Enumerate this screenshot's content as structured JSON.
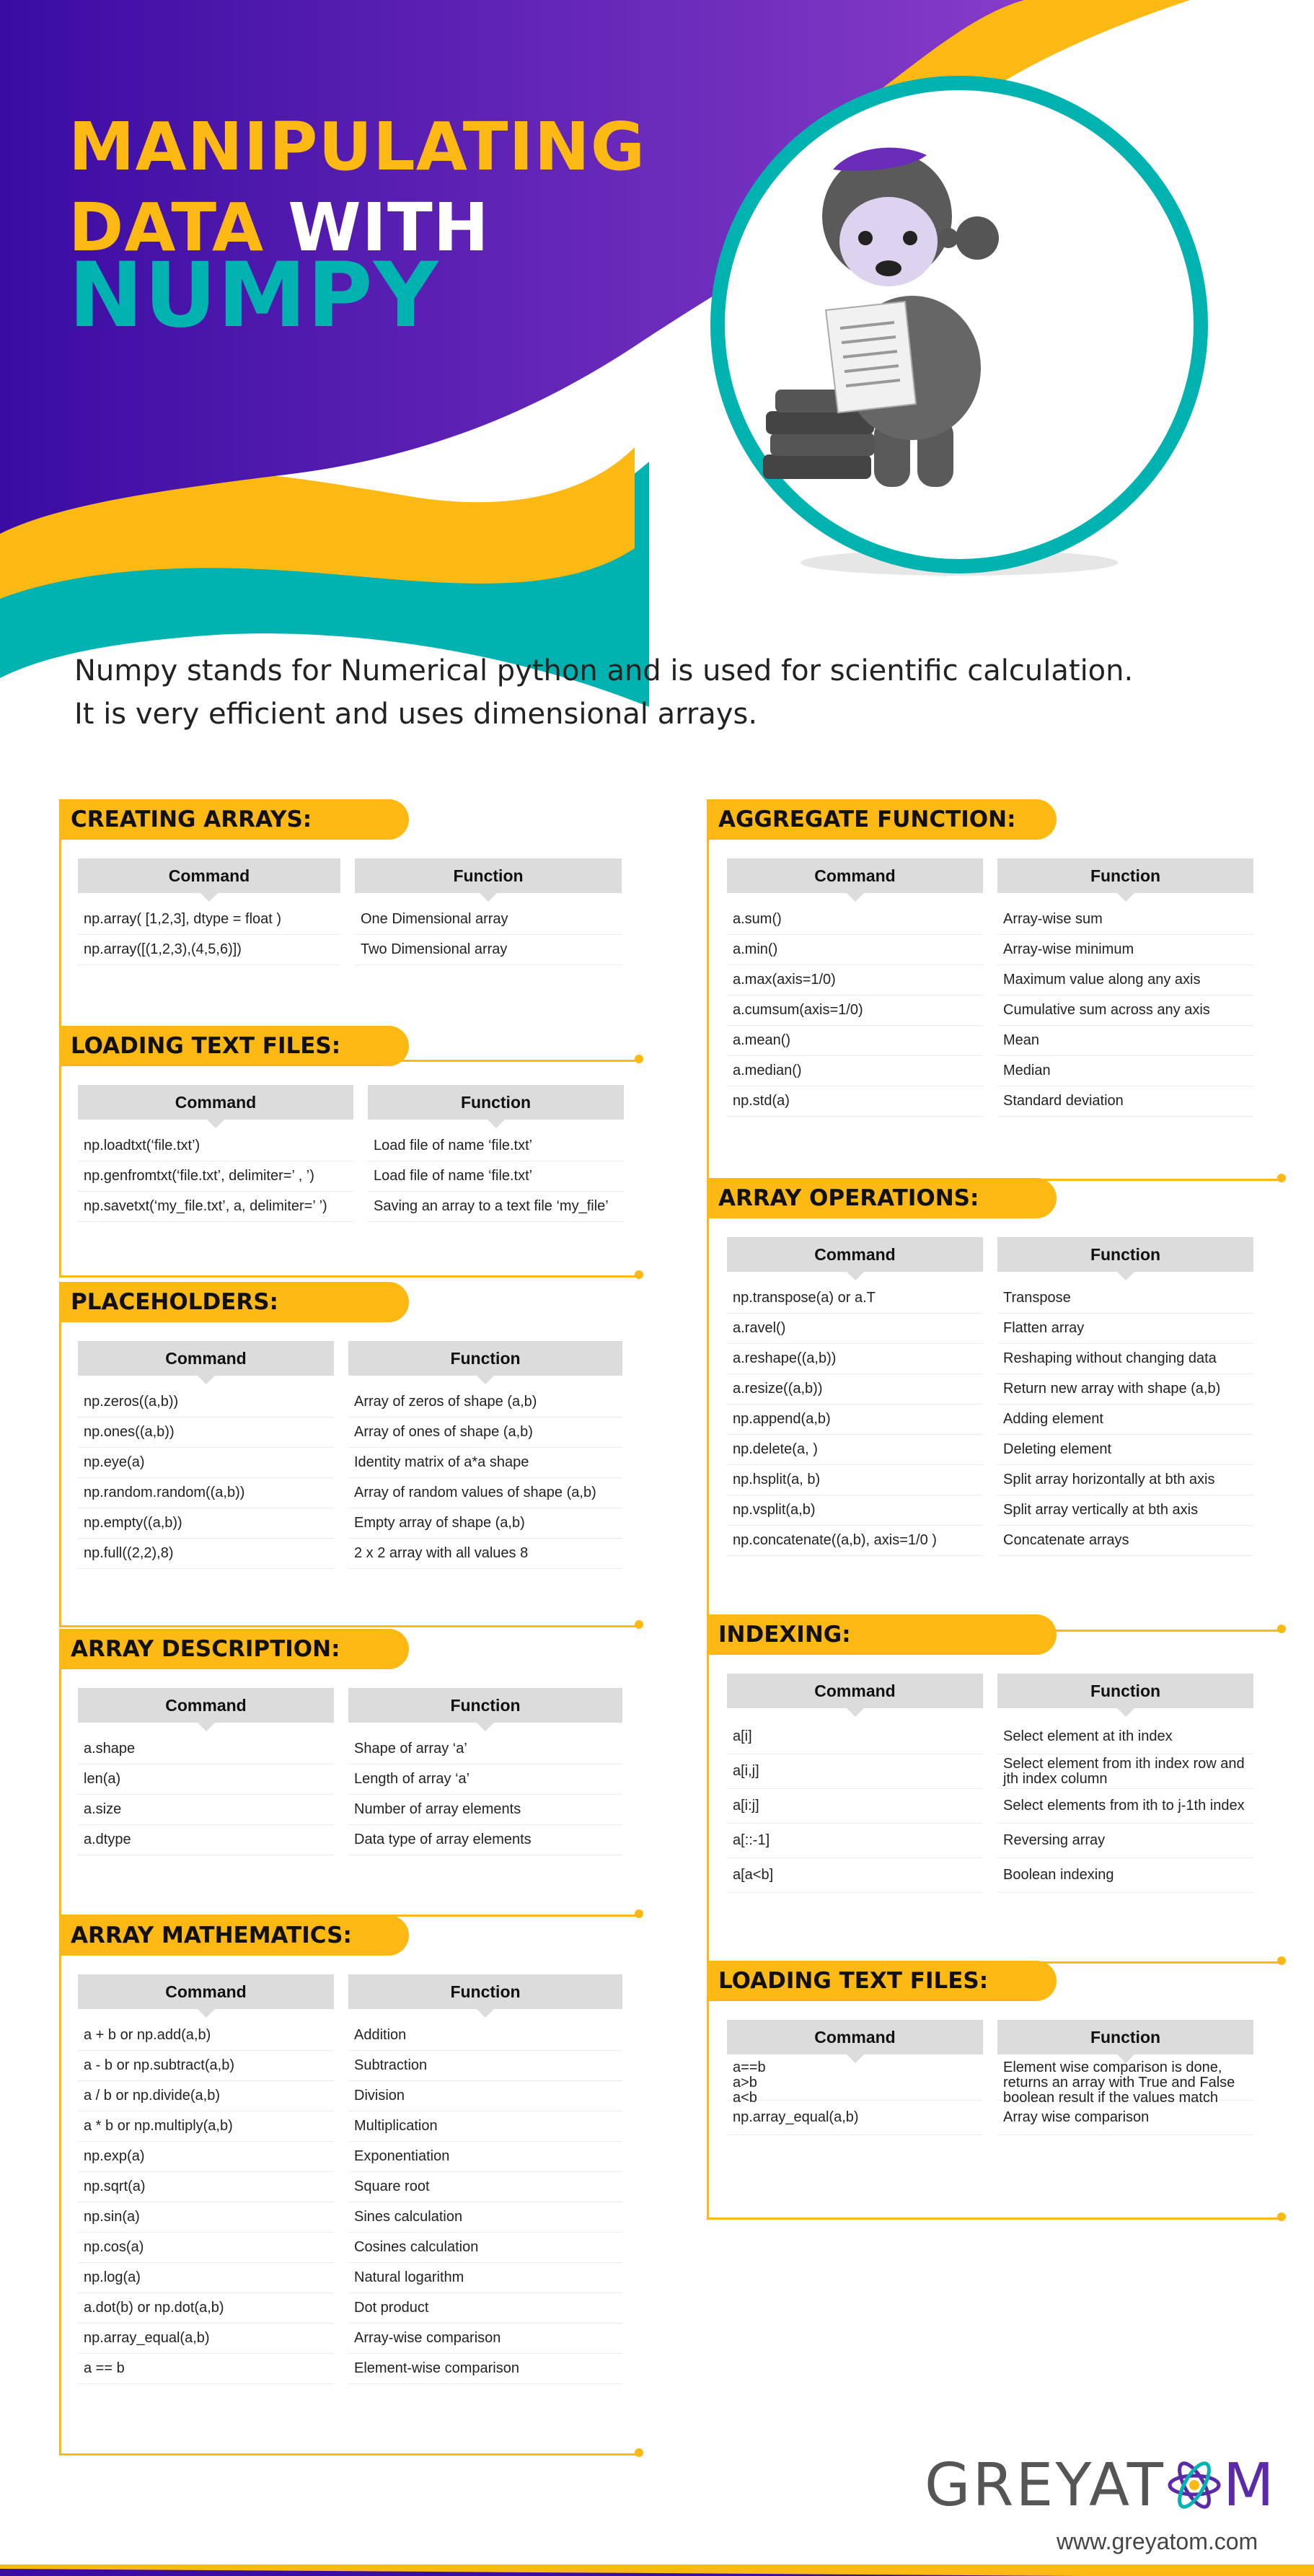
{
  "title": {
    "line1": "MANIPULATING",
    "line2a": "DATA",
    "line2b": " WITH",
    "line3": "NUMPY"
  },
  "intro": {
    "line1": "Numpy stands for Numerical python and is used for scientific calculation.",
    "line2": "It is very efficient and uses dimensional arrays."
  },
  "colors": {
    "purple": "#3e0fa8",
    "yellow": "#fdb913",
    "teal": "#00b3b0",
    "header_gray": "#dcdcdc"
  },
  "sections": [
    {
      "title": "CREATING ARRAYS:",
      "headers": [
        "Command",
        "Function"
      ],
      "rows": [
        [
          "np.array( [1,2,3], dtype = float )",
          "One Dimensional array"
        ],
        [
          "np.array([(1,2,3),(4,5,6)])",
          "Two Dimensional  array"
        ]
      ]
    },
    {
      "title": "LOADING TEXT FILES:",
      "headers": [
        "Command",
        "Function"
      ],
      "rows": [
        [
          "np.loadtxt(‘file.txt’)",
          "Load file of name ‘file.txt’"
        ],
        [
          "np.genfromtxt(‘file.txt’, delimiter=’ , ’)",
          "Load file of name ‘file.txt’"
        ],
        [
          "np.savetxt(‘my_file.txt’, a, delimiter=’  ’)",
          "Saving an array to a text file ‘my_file’"
        ]
      ]
    },
    {
      "title": "PLACEHOLDERS:",
      "headers": [
        "Command",
        "Function"
      ],
      "rows": [
        [
          "np.zeros((a,b))",
          "Array of zeros of shape (a,b)"
        ],
        [
          "np.ones((a,b))",
          "Array of ones of shape (a,b)"
        ],
        [
          "np.eye(a)",
          "Identity matrix of a*a shape"
        ],
        [
          "np.random.random((a,b))",
          "Array of random values of shape (a,b)"
        ],
        [
          "np.empty((a,b))",
          "Empty array of shape (a,b)"
        ],
        [
          "np.full((2,2),8)",
          "2 x 2 array with all values 8"
        ]
      ]
    },
    {
      "title": "ARRAY DESCRIPTION:",
      "headers": [
        "Command",
        "Function"
      ],
      "rows": [
        [
          "a.shape",
          "Shape of array ‘a’"
        ],
        [
          "len(a)",
          "Length of array ‘a’"
        ],
        [
          "a.size",
          "Number of array elements"
        ],
        [
          "a.dtype",
          "Data type of array elements"
        ]
      ]
    },
    {
      "title": "ARRAY MATHEMATICS:",
      "headers": [
        "Command",
        "Function"
      ],
      "rows": [
        [
          "a + b or np.add(a,b)",
          "Addition"
        ],
        [
          "a - b or np.subtract(a,b)",
          "Subtraction"
        ],
        [
          "a / b or np.divide(a,b)",
          "Division"
        ],
        [
          "a * b or np.multiply(a,b)",
          "Multiplication"
        ],
        [
          "np.exp(a)",
          "Exponentiation"
        ],
        [
          "np.sqrt(a)",
          "Square root"
        ],
        [
          "np.sin(a)",
          "Sines calculation"
        ],
        [
          "np.cos(a)",
          "Cosines calculation"
        ],
        [
          "np.log(a)",
          "Natural logarithm"
        ],
        [
          "a.dot(b) or np.dot(a,b)",
          "Dot product"
        ],
        [
          "np.array_equal(a,b)",
          "Array-wise comparison"
        ],
        [
          "a == b",
          "Element-wise comparison"
        ]
      ]
    },
    {
      "title": "AGGREGATE FUNCTION:",
      "headers": [
        "Command",
        "Function"
      ],
      "rows": [
        [
          "a.sum()",
          "Array-wise sum"
        ],
        [
          "a.min()",
          "Array-wise minimum"
        ],
        [
          "a.max(axis=1/0)",
          "Maximum value along any axis"
        ],
        [
          "a.cumsum(axis=1/0)",
          "Cumulative sum across any axis"
        ],
        [
          "a.mean()",
          "Mean"
        ],
        [
          "a.median()",
          "Median"
        ],
        [
          "np.std(a)",
          "Standard deviation"
        ]
      ]
    },
    {
      "title": "ARRAY OPERATIONS:",
      "headers": [
        "Command",
        "Function"
      ],
      "rows": [
        [
          "np.transpose(a) or a.T",
          "Transpose"
        ],
        [
          "a.ravel()",
          "Flatten array"
        ],
        [
          "a.reshape((a,b))",
          "Reshaping without changing data"
        ],
        [
          "a.resize((a,b))",
          "Return new array with shape (a,b)"
        ],
        [
          "np.append(a,b)",
          "Adding element"
        ],
        [
          "np.delete(a, )",
          "Deleting element"
        ],
        [
          "np.hsplit(a, b)",
          "Split array horizontally at bth axis"
        ],
        [
          "np.vsplit(a,b)",
          "Split array vertically at bth axis"
        ],
        [
          "np.concatenate((a,b), axis=1/0 )",
          "Concatenate arrays"
        ]
      ]
    },
    {
      "title": "INDEXING:",
      "headers": [
        "Command",
        "Function"
      ],
      "rows": [
        [
          "a[i]",
          "Select element at ith index"
        ],
        [
          "a[i,j]",
          "Select element from ith index row and jth index column"
        ],
        [
          "a[i:j]",
          "Select elements from ith to j-1th index"
        ],
        [
          "a[::-1]",
          "Reversing array"
        ],
        [
          "a[a<b]",
          "Boolean indexing"
        ]
      ]
    },
    {
      "title": "LOADING TEXT FILES:",
      "headers": [
        "Command",
        "Function"
      ],
      "rows": [
        [
          "a==b\na>b\na<b",
          "Element wise comparison is done, returns an array with True and False boolean result if the values match"
        ],
        [
          "np.array_equal(a,b)",
          "Array wise comparison"
        ]
      ]
    }
  ],
  "footer": {
    "brand_part1": "GREYAT",
    "brand_part2": "M",
    "url": "www.greyatom.com"
  }
}
